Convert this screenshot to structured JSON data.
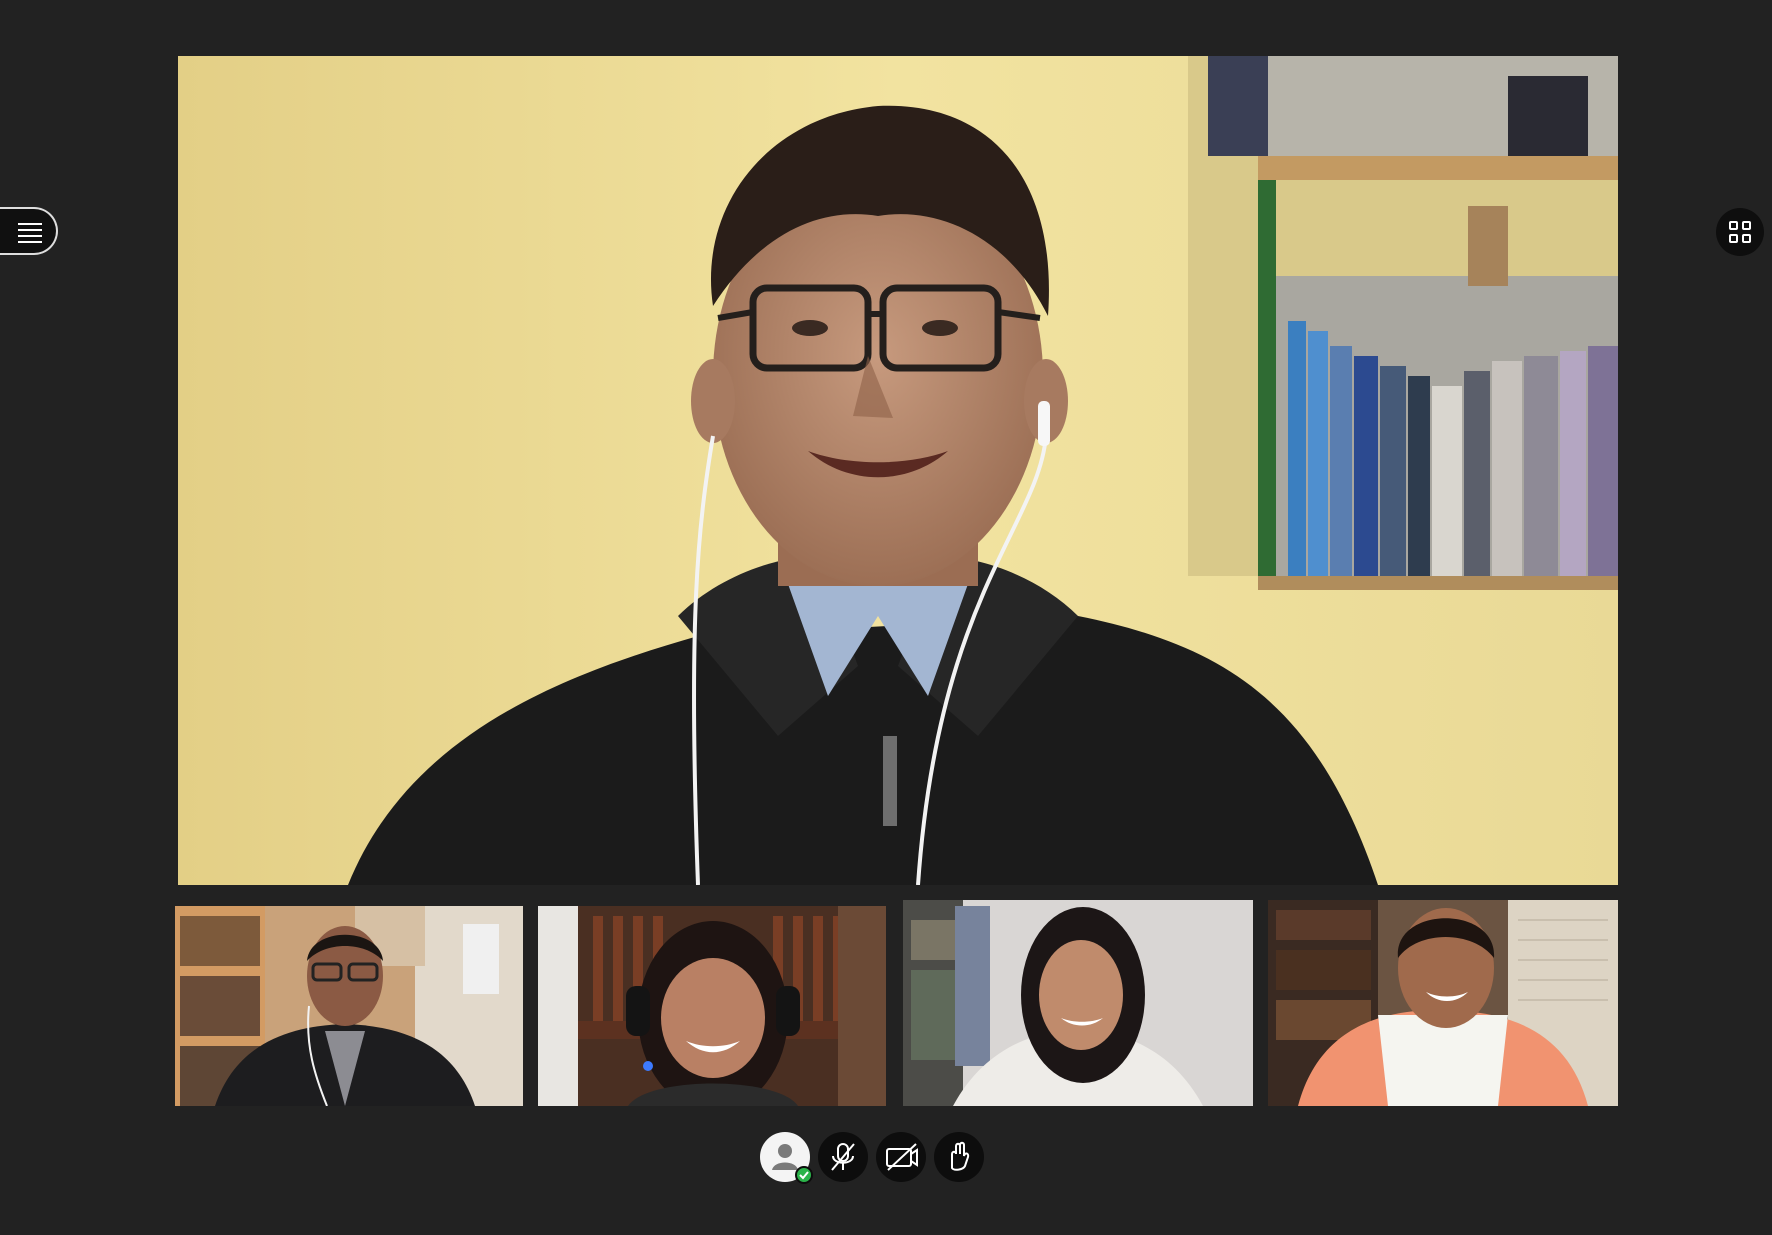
{
  "app": {
    "background_color": "#222222"
  },
  "main_speaker": {
    "description_icon": "main-speaker-video",
    "wall_color": "#eedd90"
  },
  "header": {
    "menu_icon": "hamburger-menu-icon",
    "layout_icon": "grid-layout-icon"
  },
  "thumbnails": [
    {
      "icon": "participant-video",
      "bg": "#b88f6a"
    },
    {
      "icon": "participant-video",
      "bg": "#5a3a2a"
    },
    {
      "icon": "participant-video",
      "bg": "#d8d4d2"
    },
    {
      "icon": "participant-video",
      "bg": "#5c4635"
    }
  ],
  "controls": {
    "items": [
      {
        "icon": "user-status-icon",
        "status_color": "#2bb34a"
      },
      {
        "icon": "microphone-muted-icon"
      },
      {
        "icon": "camera-off-icon"
      },
      {
        "icon": "raise-hand-icon"
      }
    ]
  }
}
